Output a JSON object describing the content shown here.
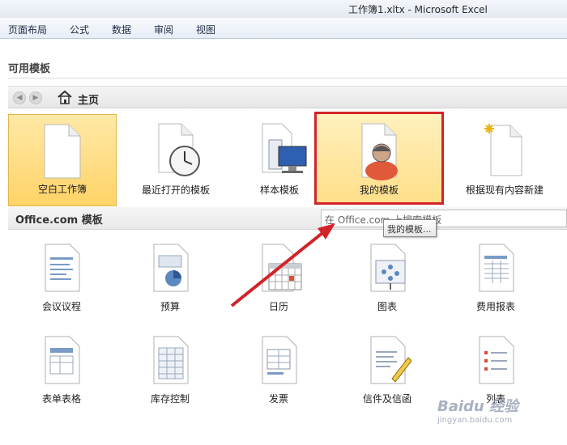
{
  "window": {
    "title": "工作簿1.xltx  -  Microsoft Excel"
  },
  "ribbon": {
    "tabs": [
      "页面布局",
      "公式",
      "数据",
      "审阅",
      "视图"
    ]
  },
  "templates": {
    "heading": "可用模板",
    "nav": {
      "back_icon": "back-arrow-icon",
      "forward_icon": "forward-arrow-icon",
      "home_label": "主页"
    },
    "tiles": [
      {
        "label": "空白工作簿",
        "icon": "blank-document-icon",
        "selected": true
      },
      {
        "label": "最近打开的模板",
        "icon": "clock-document-icon"
      },
      {
        "label": "样本模板",
        "icon": "computer-document-icon"
      },
      {
        "label": "我的模板",
        "icon": "person-document-icon",
        "highlighted": true
      },
      {
        "label": "根据现有内容新建",
        "icon": "sparkle-document-icon"
      }
    ]
  },
  "office": {
    "heading": "Office.com 模板",
    "search_placeholder": "在 Office.com 上搜索模板",
    "tooltip": "我的模板...",
    "items": [
      {
        "label": "会议议程",
        "icon": "agenda-icon"
      },
      {
        "label": "预算",
        "icon": "budget-icon"
      },
      {
        "label": "日历",
        "icon": "calendar-icon"
      },
      {
        "label": "图表",
        "icon": "chart-icon"
      },
      {
        "label": "费用报表",
        "icon": "expense-report-icon"
      },
      {
        "label": "表单表格",
        "icon": "form-icon"
      },
      {
        "label": "库存控制",
        "icon": "inventory-icon"
      },
      {
        "label": "发票",
        "icon": "invoice-icon"
      },
      {
        "label": "信件及信函",
        "icon": "letter-icon"
      },
      {
        "label": "列表",
        "icon": "list-icon"
      }
    ]
  },
  "watermark": {
    "brand": "Baidu 经验",
    "sub": "jingyan.baidu.com"
  },
  "colors": {
    "selected_tile": "#ffd367",
    "highlight_border": "#d2232a",
    "arrow": "#d2232a"
  }
}
